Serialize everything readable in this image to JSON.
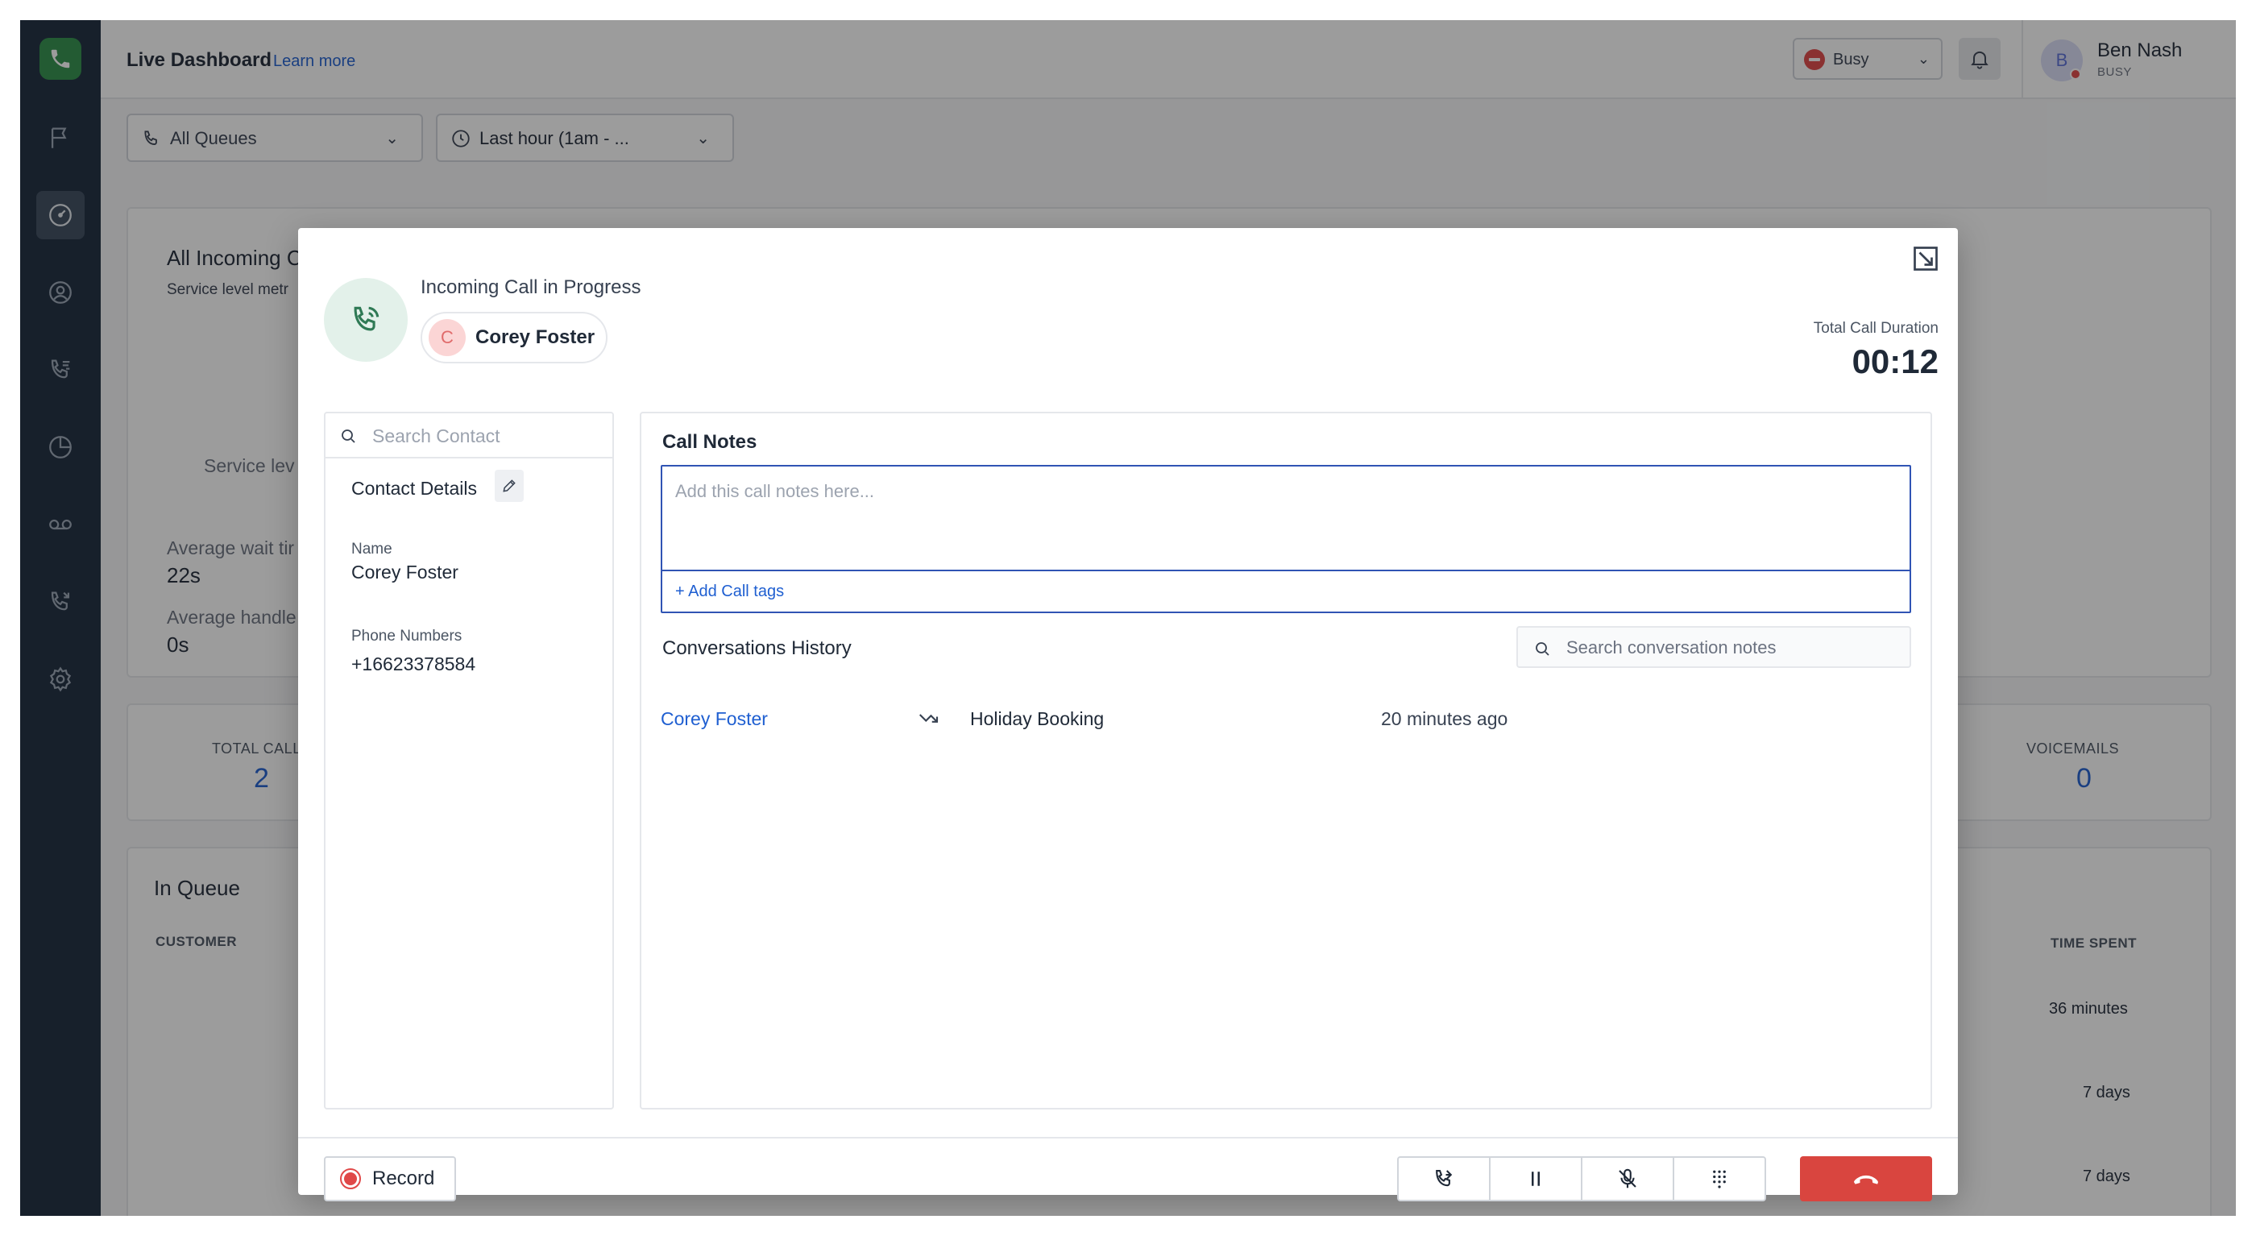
{
  "topbar": {
    "title": "Live Dashboard",
    "learn_more": "Learn more",
    "status_label": "Busy",
    "user_initial": "B",
    "user_name": "Ben Nash",
    "user_status": "BUSY"
  },
  "filters": {
    "queue": "All Queues",
    "timeframe": "Last hour (1am - ..."
  },
  "background": {
    "incoming_title": "All Incoming C",
    "service_subtitle": "Service level metr",
    "gauge_label": "Service lev",
    "avg_wait_label": "Average wait tir",
    "avg_wait_value": "22s",
    "avg_handle_label": "Average handle",
    "avg_handle_value": "0s",
    "total_calls_label": "TOTAL CALL",
    "total_calls_value": "2",
    "voicemails_label": "VOICEMAILS",
    "voicemails_value": "0",
    "in_queue_title": "In Queue",
    "customer_col": "CUSTOMER",
    "time_spent_col": "TIME SPENT",
    "rows": [
      {
        "time": "36 minutes"
      },
      {
        "time": "7 days"
      },
      {
        "time": "7 days"
      }
    ]
  },
  "modal": {
    "call_title": "Incoming Call in Progress",
    "contact_initial": "C",
    "contact_name": "Corey Foster",
    "duration_label": "Total Call Duration",
    "duration_value": "00:12",
    "search_contact_placeholder": "Search Contact",
    "contact_details_title": "Contact Details",
    "name_label": "Name",
    "name_value": "Corey Foster",
    "phone_label": "Phone Numbers",
    "phone_value": "+16623378584",
    "call_notes_title": "Call Notes",
    "call_notes_placeholder": "Add this call notes here...",
    "add_call_tags": "+ Add Call tags",
    "history_title": "Conversations History",
    "history_search_placeholder": "Search conversation notes",
    "history": [
      {
        "name": "Corey Foster",
        "subject": "Holiday Booking",
        "time": "20 minutes ago"
      }
    ],
    "record_label": "Record"
  },
  "colors": {
    "sidebar": "#1b2a3d",
    "accent_blue": "#1f5fd1",
    "hangup_red": "#d9453f",
    "brand_green": "#2f8f4a"
  }
}
